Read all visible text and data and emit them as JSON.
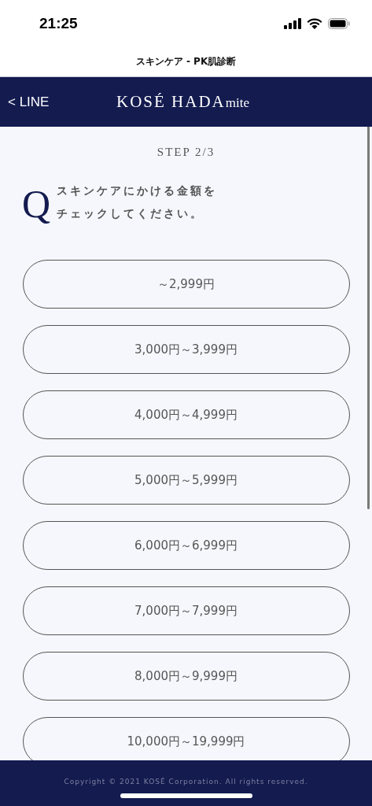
{
  "status_bar": {
    "time": "21:25"
  },
  "browser_title": "スキンケア - PK肌診断",
  "header": {
    "back_label": "< LINE",
    "logo_main": "KOSÉ HADA",
    "logo_sub": "mite"
  },
  "step": "STEP 2/3",
  "question": {
    "mark": "Q",
    "lines": [
      "スキンケアにかける金額を",
      "チェックしてください。"
    ]
  },
  "options": [
    {
      "label": "～2,999円",
      "selected": false
    },
    {
      "label": "3,000円～3,999円",
      "selected": false
    },
    {
      "label": "4,000円～4,999円",
      "selected": false
    },
    {
      "label": "5,000円～5,999円",
      "selected": false
    },
    {
      "label": "6,000円～6,999円",
      "selected": false
    },
    {
      "label": "7,000円～7,999円",
      "selected": false
    },
    {
      "label": "8,000円～9,999円",
      "selected": false
    },
    {
      "label": "10,000円～19,999円",
      "selected": false
    }
  ],
  "footer": {
    "copyright": "Copyright © 2021 KOSÉ Corporation. All rights reserved."
  }
}
